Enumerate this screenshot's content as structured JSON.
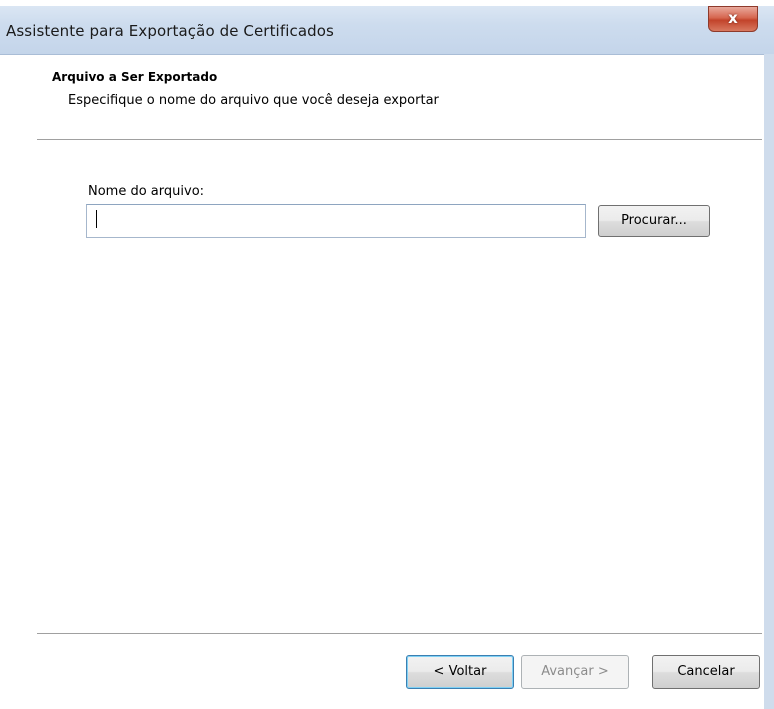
{
  "window": {
    "title": "Assistente para Exportação de Certificados",
    "close_glyph": "x"
  },
  "header": {
    "title": "Arquivo a Ser Exportado",
    "subtitle": "Especifique o nome do arquivo que você deseja exportar"
  },
  "form": {
    "filename_label": "Nome do arquivo:",
    "filename_value": "",
    "browse_label": "Procurar..."
  },
  "footer": {
    "back_label": "< Voltar",
    "next_label": "Avançar >",
    "cancel_label": "Cancelar"
  },
  "colors": {
    "titlebar": "#cddcee",
    "close_button": "#c2432a",
    "focus_border": "#3c7fb1",
    "disabled_text": "#8c8c8c"
  }
}
